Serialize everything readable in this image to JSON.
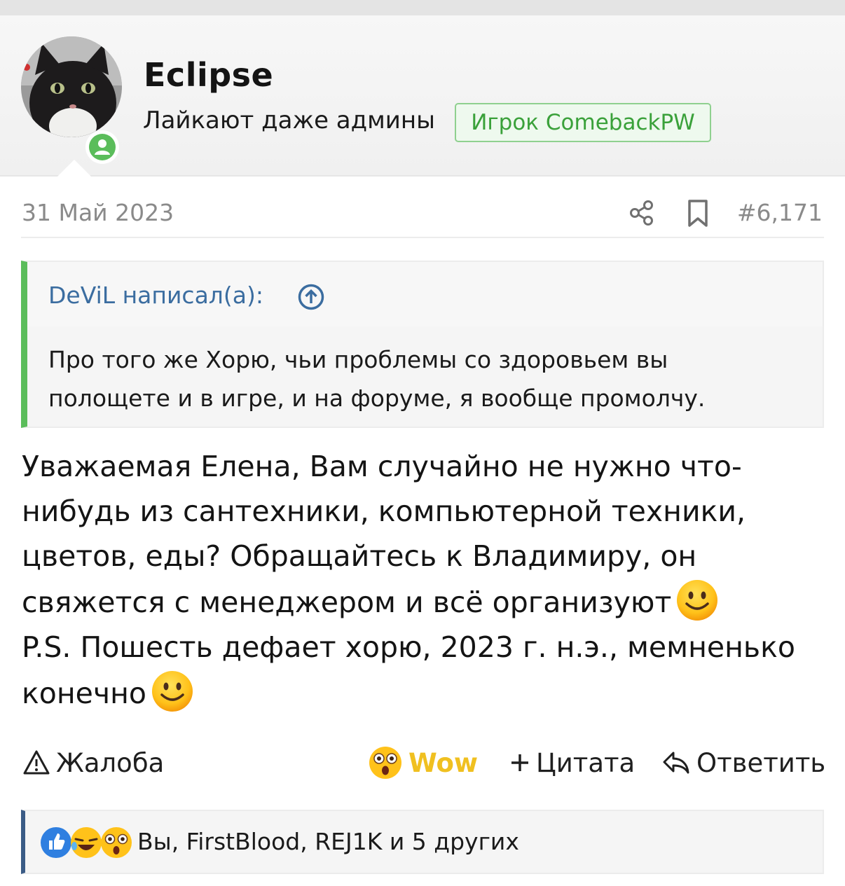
{
  "user": {
    "name": "Eclipse",
    "title": "Лайкают даже админы",
    "banner": "Игрок ComebackPW",
    "online_icon": "user-online-icon"
  },
  "post": {
    "date": "31 Май 2023",
    "number": "#6,171",
    "quote": {
      "author": "DeViL написал(а):",
      "text": "Про того же Хорю, чьи проблемы со здоровьем вы полощете и в игре, и на форуме, я вообще промолчу."
    },
    "body": {
      "line1": "Уважаемая Елена, Вам случайно не нужно что-нибудь из сантехники, компьютерной техники, цветов, еды? Обращайтесь к Владимиру, он свяжется с менеджером и всё организуют",
      "line2": "P.S. Пошесть дефает хорю, 2023 г. н.э., мемненько конечно"
    }
  },
  "actions": {
    "report": "Жалоба",
    "reaction": "Wow",
    "quote": "Цитата",
    "reply": "Ответить"
  },
  "reactions": {
    "summary": "Вы, FirstBlood, REJ1K и 5 других",
    "icons": [
      "like-icon",
      "laugh-icon",
      "wow-icon"
    ]
  },
  "colors": {
    "accent_green": "#5bbd5b",
    "link_blue": "#3b6da0",
    "wow_yellow": "#f0c020"
  }
}
